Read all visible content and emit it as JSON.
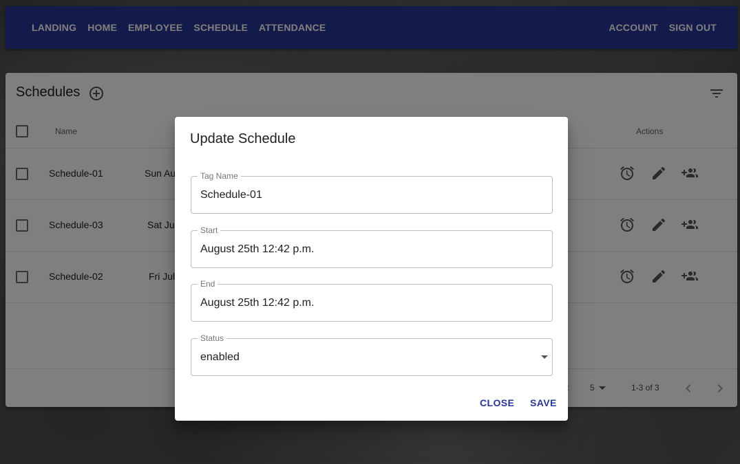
{
  "nav": {
    "left": [
      "LANDING",
      "HOME",
      "EMPLOYEE",
      "SCHEDULE",
      "ATTENDANCE"
    ],
    "right": [
      "ACCOUNT",
      "SIGN OUT"
    ]
  },
  "card": {
    "title": "Schedules",
    "columns": {
      "name": "Name",
      "actions": "Actions"
    },
    "rows": [
      {
        "name": "Schedule-01",
        "start": "Sun Au"
      },
      {
        "name": "Schedule-03",
        "start": "Sat Ju"
      },
      {
        "name": "Schedule-02",
        "start": "Fri Jul"
      }
    ],
    "footer": {
      "rows_per_page_label": "e:",
      "rows_per_page": "5",
      "range": "1-3 of 3"
    }
  },
  "dialog": {
    "title": "Update Schedule",
    "fields": {
      "tag_name": {
        "label": "Tag Name",
        "value": "Schedule-01"
      },
      "start": {
        "label": "Start",
        "value": "August 25th 12:42 p.m."
      },
      "end": {
        "label": "End",
        "value": "August 25th 12:42 p.m."
      },
      "status": {
        "label": "Status",
        "value": "enabled"
      }
    },
    "close_label": "CLOSE",
    "save_label": "SAVE"
  },
  "colors": {
    "appbar": "#283593",
    "primary_text": "#212121",
    "accent": "#283593"
  },
  "icons": {
    "add": "add-circle-outline-icon",
    "filter": "filter-list-icon",
    "alarm": "alarm-icon",
    "edit": "pencil-icon",
    "assign": "group-add-icon",
    "prev": "chevron-left-icon",
    "next": "chevron-right-icon"
  }
}
